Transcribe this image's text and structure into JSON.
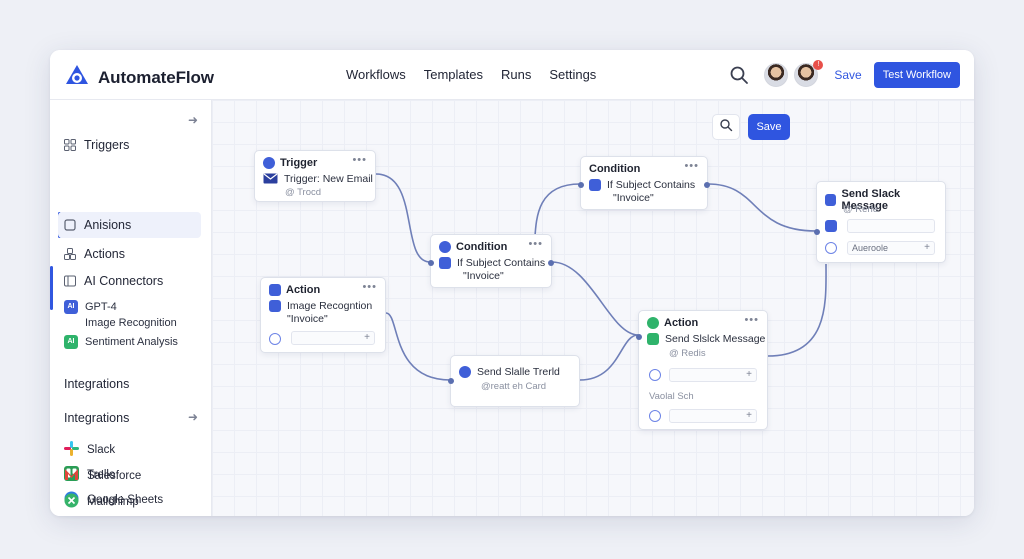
{
  "brand": {
    "name": "AutomateFlow",
    "accent": "#2f55e0"
  },
  "nav": [
    "Workflows",
    "Templates",
    "Runs",
    "Settings"
  ],
  "header": {
    "save_label": "Save",
    "test_label": "Test Workflow",
    "notification_count": "!"
  },
  "sidebar": {
    "items": [
      {
        "label": "Triggers",
        "icon": "grid-icon"
      },
      {
        "label": "Anisions",
        "icon": "square-icon"
      },
      {
        "label": "Actions",
        "icon": "blocks-icon"
      },
      {
        "label": "AI Connectors",
        "icon": "panel-icon"
      }
    ],
    "ai_items": [
      {
        "label": "GPT-4",
        "badge": "AI"
      },
      {
        "label": "Image Recognition",
        "badge": ""
      },
      {
        "label": "Sentiment Analysis",
        "badge": "AI"
      }
    ],
    "section_1": "Integrations",
    "section_2": "Integrations",
    "integrations": [
      "Slack",
      "Trello",
      "Google Sheets",
      "Salesforce",
      "Mallchimp"
    ]
  },
  "canvas": {
    "save_label": "Save",
    "nodes": {
      "trigger": {
        "title": "Trigger",
        "line1": "Trigger: New Email",
        "line2": "@ Trocd"
      },
      "condition1": {
        "title": "Condition",
        "line1": "If Subject Contains",
        "line2": "\"Invoice\""
      },
      "condition2": {
        "title": "Condition",
        "line1": "If Subject Contains",
        "line2": "\"Invoice\""
      },
      "action1": {
        "title": "Action",
        "line1": "Image Recogntion",
        "line2": "\"Invoice\""
      },
      "send_trello": {
        "line1": "Send Slalle Trerld",
        "line2": "@reatt eh Card"
      },
      "action2": {
        "title": "Action",
        "line1": "Send Slslck Message",
        "line2": "@ Redis",
        "field_label": "Vaolal Sch"
      },
      "slack": {
        "title": "Send Slack Message",
        "line1": "@ Rerle",
        "field_label": "Aueroole"
      }
    }
  }
}
